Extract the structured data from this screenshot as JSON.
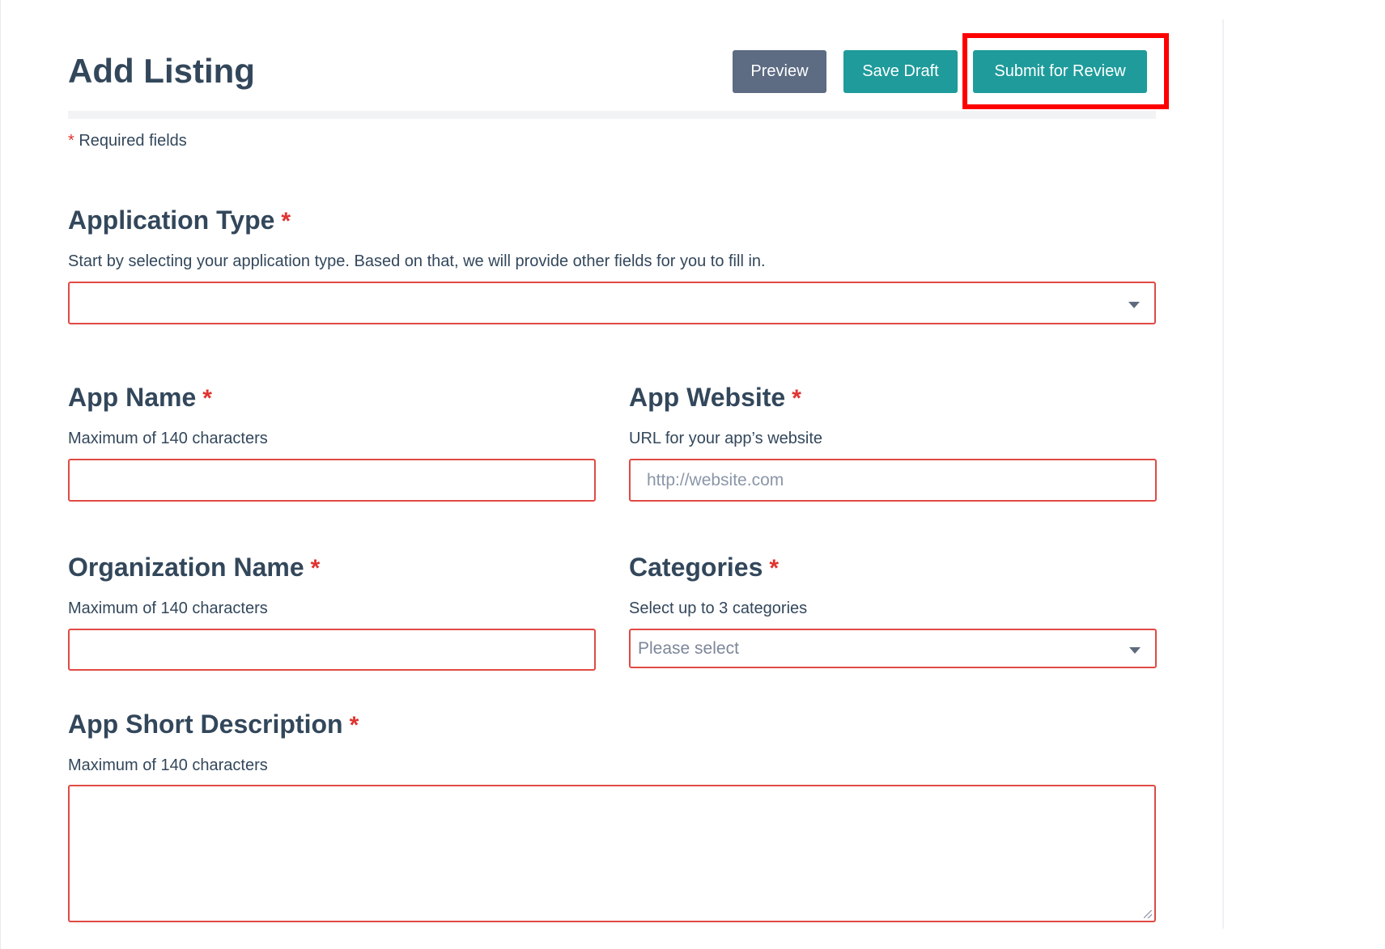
{
  "header": {
    "title": "Add Listing",
    "preview_label": "Preview",
    "save_draft_label": "Save Draft",
    "submit_label": "Submit for Review"
  },
  "required_note": {
    "star": "*",
    "text": " Required fields"
  },
  "star": "*",
  "application_type": {
    "label": "Application Type",
    "help": "Start by selecting your application type. Based on that, we will provide other fields for you to fill in.",
    "value": ""
  },
  "app_name": {
    "label": "App Name",
    "help": "Maximum of 140 characters",
    "value": ""
  },
  "app_website": {
    "label": "App Website",
    "help": "URL for your app’s website",
    "placeholder": "http://website.com"
  },
  "organization_name": {
    "label": "Organization Name",
    "help": "Maximum of 140 characters",
    "value": ""
  },
  "categories": {
    "label": "Categories",
    "help": "Select up to 3 categories",
    "placeholder": "Please select"
  },
  "app_short_description": {
    "label": "App Short Description",
    "help": "Maximum of 140 characters",
    "value": ""
  },
  "colors": {
    "primary_teal": "#1f9b9b",
    "preview_gray": "#5d6b83",
    "error_red": "#e04a44",
    "highlight_red": "#ff0000",
    "text": "#33475b"
  }
}
